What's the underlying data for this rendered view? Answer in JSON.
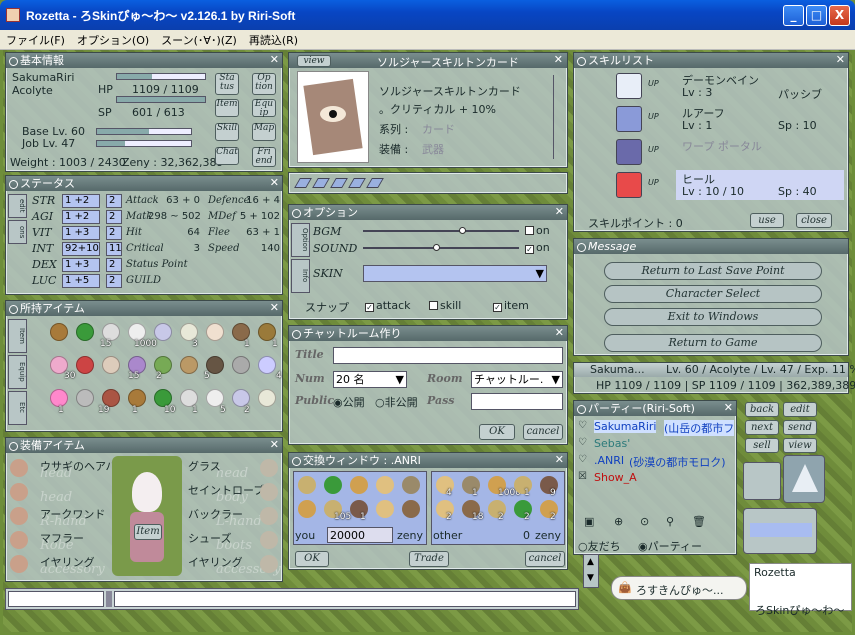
{
  "window": {
    "title": "Rozetta - ろSkinぴゅ〜わ〜 v2.126.1 by Riri-Soft",
    "min": "_",
    "max": "□",
    "close": "X"
  },
  "menu": [
    "ファイル(F)",
    "オプション(O)",
    "スーン(･∀･)(Z)",
    "再読込(R)"
  ],
  "basic": {
    "title": "基本情報",
    "name": "SakumaRiri",
    "job": "Acolyte",
    "hp_label": "HP",
    "hp": "1109 / 1109",
    "sp_label": "SP",
    "sp": "601 / 613",
    "hp_frac": 1.0,
    "sp_frac": 0.98,
    "base_lv": "Base Lv. 60",
    "job_lv": "Job Lv. 47",
    "weight": "Weight : 1003 / 2430",
    "zeny": "Zeny : 32,362,389",
    "buttons": [
      "Sta tus",
      "Op tion",
      "Item",
      "Equ ip",
      "Skill",
      "Map",
      "Chat",
      "Fri end"
    ]
  },
  "status": {
    "title": "ステータス",
    "side": [
      "edit",
      "ons"
    ],
    "stats": [
      {
        "k": "STR",
        "v": "1 +2",
        "p": "2"
      },
      {
        "k": "AGI",
        "v": "1 +2",
        "p": "2"
      },
      {
        "k": "VIT",
        "v": "1 +3",
        "p": "2"
      },
      {
        "k": "INT",
        "v": "92+10",
        "p": "11"
      },
      {
        "k": "DEX",
        "v": "1 +3",
        "p": "2"
      },
      {
        "k": "LUC",
        "v": "1 +5",
        "p": "2"
      }
    ],
    "left": [
      {
        "k": "Attack",
        "v": "63 + 0"
      },
      {
        "k": "Matk",
        "v": "298 ~ 502"
      },
      {
        "k": "Hit",
        "v": "64"
      },
      {
        "k": "Critical",
        "v": "3"
      },
      {
        "k": "Status Point",
        "v": ""
      },
      {
        "k": "GUILD",
        "v": ""
      }
    ],
    "right": [
      {
        "k": "Defence",
        "v": "16 + 4"
      },
      {
        "k": "MDef",
        "v": "5 + 102"
      },
      {
        "k": "Flee",
        "v": "63 + 1"
      },
      {
        "k": "Speed",
        "v": "140"
      }
    ]
  },
  "items": {
    "title": "所持アイテム",
    "tabs": [
      "Item",
      "Equip",
      "Etc"
    ],
    "qty": [
      "15",
      "1000",
      "3",
      "1",
      "1",
      "30",
      "15",
      "2",
      "5",
      "4",
      "1",
      "19",
      "1",
      "10",
      "1",
      "5",
      "2"
    ]
  },
  "equip": {
    "title": "装備アイテム",
    "left": [
      "ウサギのヘアバンド",
      "",
      "アークワンド",
      "マフラー",
      "イヤリング"
    ],
    "left_wm": [
      "head",
      "head",
      "R-hand",
      "Robe",
      "accessory"
    ],
    "right": [
      "グラス",
      "セイントローブ",
      "バックラー",
      "シューズ",
      "イヤリング"
    ],
    "right_wm": [
      "head",
      "body",
      "L-hand",
      "boots",
      "accessory"
    ],
    "item_btn": "Item"
  },
  "card": {
    "view": "view",
    "title": "ソルジャースキルトンカード",
    "name": "ソルジャースキルトンカード",
    "desc": "。クリティカル + 10%",
    "series_label": "系列 :",
    "series": "カード",
    "equip_label": "装備 :",
    "equip": "武器"
  },
  "option": {
    "title": "オプション",
    "side": [
      "Option",
      "Info"
    ],
    "bgm": "BGM",
    "sound": "SOUND",
    "skin": "SKIN",
    "on": "on",
    "bgm_on": false,
    "sound_on": true,
    "snap": "スナップ",
    "snap_items": [
      {
        "l": "attack",
        "c": true
      },
      {
        "l": "skill",
        "c": false
      },
      {
        "l": "item",
        "c": true
      }
    ]
  },
  "chatroom": {
    "title": "チャットルーム作り",
    "title_l": "Title",
    "num_l": "Num",
    "num": "20 名",
    "room_l": "Room",
    "room": "チャットルー.",
    "public_l": "Public",
    "public": "公開",
    "private": "非公開",
    "pass_l": "Pass",
    "ok": "OK",
    "cancel": "cancel"
  },
  "trade": {
    "title": "交換ウィンドウ : .ANRI",
    "you": "you",
    "you_zeny": "20000",
    "zeny": "zeny",
    "other": "other",
    "other_zeny": "0",
    "ok": "OK",
    "tradebtn": "Trade",
    "cancel": "cancel",
    "you_qty": [
      "",
      "",
      "",
      "",
      "",
      "",
      "105",
      "1",
      "",
      ""
    ],
    "other_qty": [
      "4",
      "1",
      "1000",
      "1",
      "9",
      "2",
      "18",
      "2",
      "2",
      "2"
    ]
  },
  "skills": {
    "title": "スキルリスト",
    "list": [
      {
        "name": "デーモンベイン",
        "lv": "Lv : 3",
        "extra": "パッシブ"
      },
      {
        "name": "ルアーフ",
        "lv": "Lv : 1",
        "extra": "Sp : 10"
      },
      {
        "name": "ワープ ポータル",
        "lv": "",
        "extra": ""
      },
      {
        "name": "ヒール",
        "lv": "Lv : 10 / 10",
        "extra": "Sp : 40"
      }
    ],
    "up": "UP",
    "point": "スキルポイント : 0",
    "use": "use",
    "close": "close"
  },
  "message": {
    "title": "Message",
    "buttons": [
      "Return to Last Save Point",
      "Character Select",
      "Exit to Windows",
      "Return to Game"
    ]
  },
  "info": {
    "name": "Sakuma...",
    "level": "Lv. 60 / Acolyte / Lv. 47 / Exp. 11 %",
    "line2": "HP 1109 / 1109 | SP 1109 / 1109 | 362,389,389 Z"
  },
  "party": {
    "title": "パーティー(Riri-Soft)",
    "members": [
      {
        "n": "SakumaRiri",
        "loc": "(山岳の都市フ",
        "color": "#1040c0"
      },
      {
        "n": "Sebas'",
        "loc": "",
        "color": "#2b7a7a"
      },
      {
        "n": ".ANRI",
        "loc": "(砂漠の都市モロク)",
        "color": "#1040c0"
      },
      {
        "n": "Show_A",
        "loc": "",
        "color": "#c01010"
      }
    ],
    "friend": "友だち",
    "party": "パーティー"
  },
  "sidebuttons": [
    "back",
    "edit",
    "next",
    "send",
    "sell",
    "view"
  ],
  "chatbox": {
    "name": "Rozetta",
    "bubble": "ろすきんぴゅ〜...",
    "footer": "ろSkinぴゅ〜わ〜"
  }
}
